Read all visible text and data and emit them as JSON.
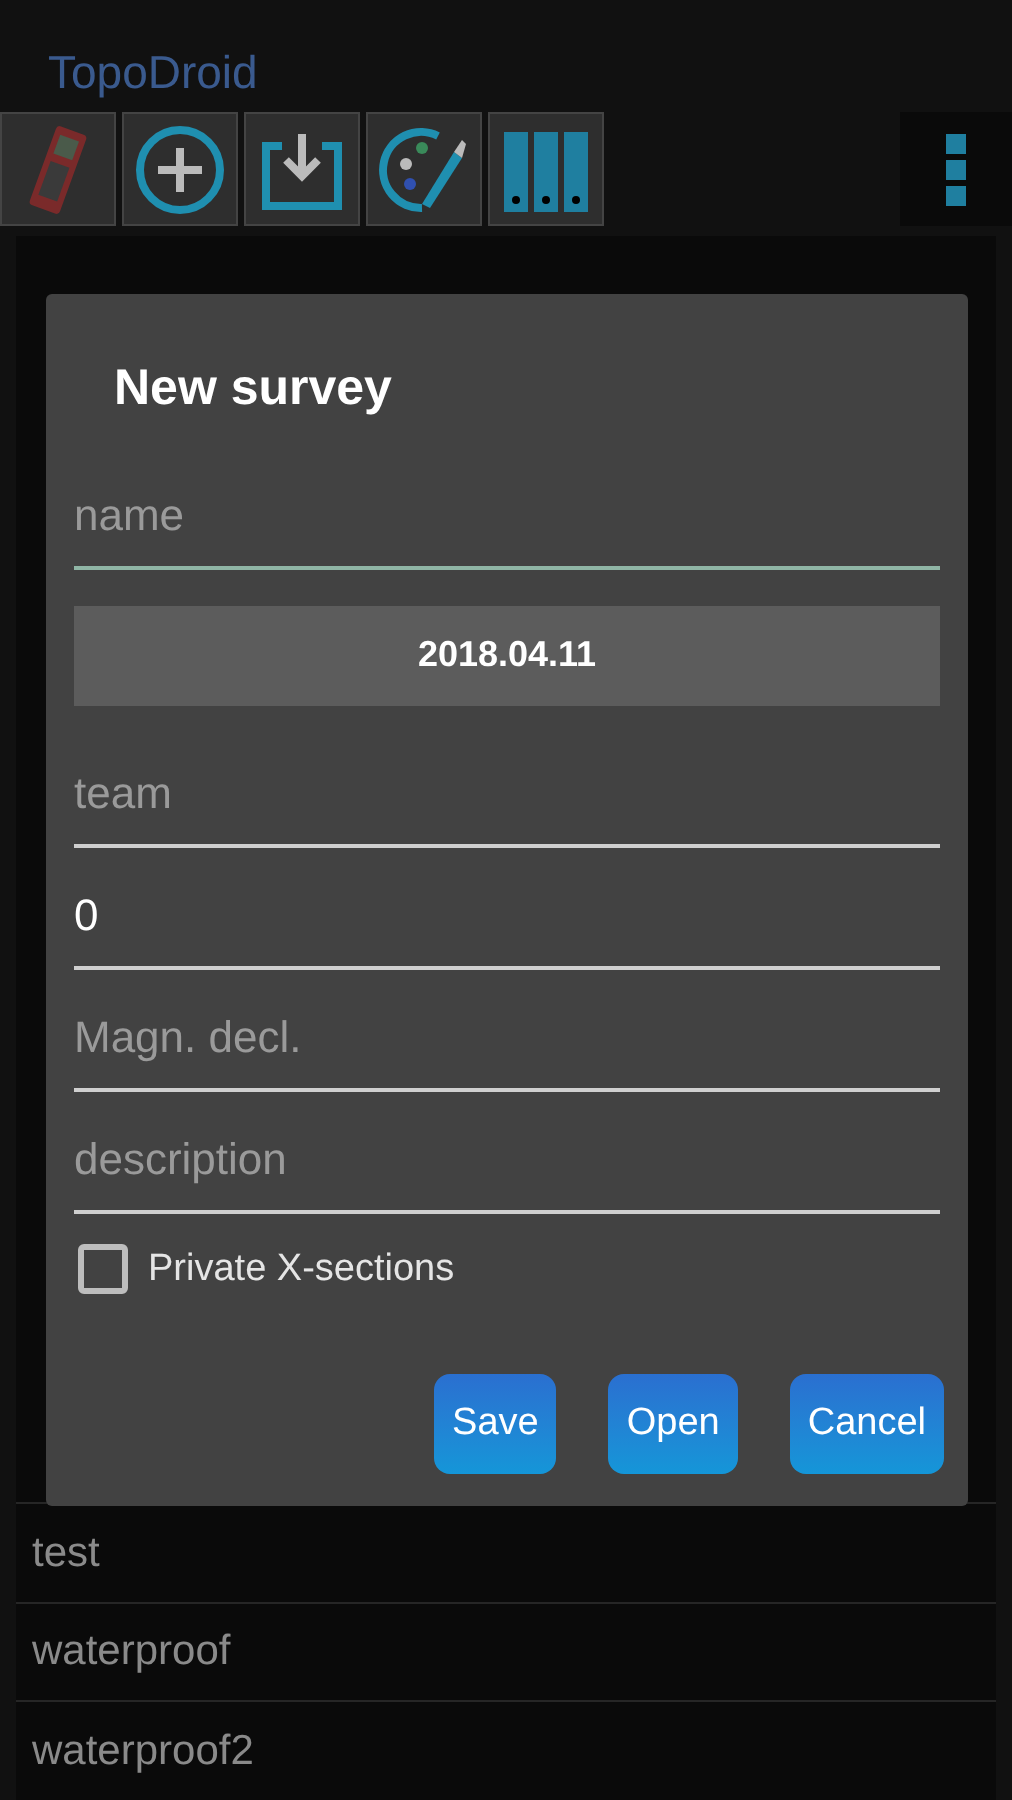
{
  "app_title": "TopoDroid",
  "surveys": [
    "test",
    "waterproof",
    "waterproof2"
  ],
  "dialog": {
    "title": "New survey",
    "fields": [
      {
        "kind": "text",
        "placeholder": "name",
        "focused": true
      },
      {
        "kind": "date",
        "value": "2018.04.11"
      },
      {
        "kind": "text",
        "placeholder": "team",
        "focused": false
      },
      {
        "kind": "text",
        "value": "0",
        "focused": false
      },
      {
        "kind": "text",
        "placeholder": "Magn. decl.",
        "focused": false
      },
      {
        "kind": "text",
        "placeholder": "description",
        "focused": false
      }
    ],
    "checkbox": {
      "label": "Private X-sections",
      "checked": false
    },
    "buttons": [
      "Save",
      "Open",
      "Cancel"
    ]
  }
}
